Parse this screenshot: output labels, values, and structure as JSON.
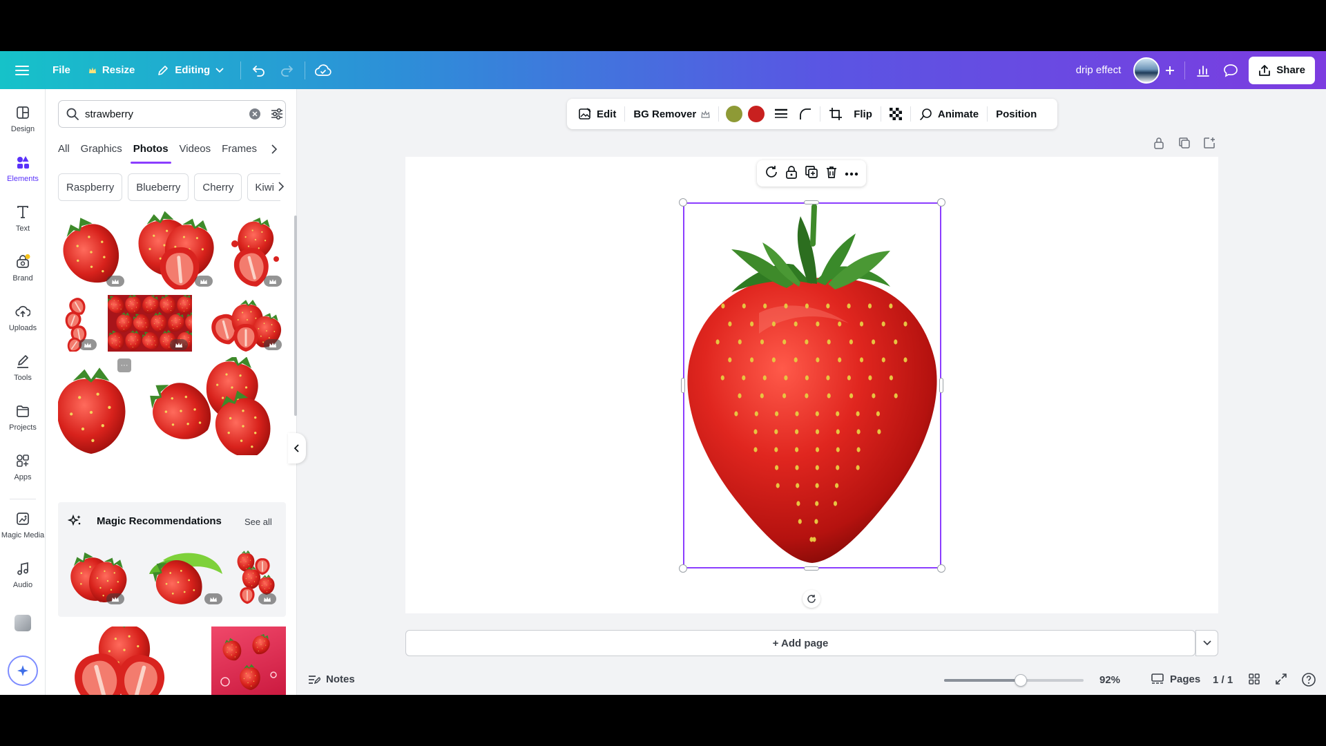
{
  "topbar": {
    "file": "File",
    "resize": "Resize",
    "editing": "Editing",
    "design_name": "drip effect",
    "share": "Share"
  },
  "rail": [
    {
      "label": "Design",
      "icon": "layout-icon"
    },
    {
      "label": "Elements",
      "icon": "elements-icon",
      "active": true
    },
    {
      "label": "Text",
      "icon": "text-icon"
    },
    {
      "label": "Brand",
      "icon": "brand-icon"
    },
    {
      "label": "Uploads",
      "icon": "cloud-upload-icon"
    },
    {
      "label": "Tools",
      "icon": "pen-icon"
    },
    {
      "label": "Projects",
      "icon": "folder-icon"
    },
    {
      "label": "Apps",
      "icon": "apps-icon"
    },
    {
      "label": "Magic Media",
      "icon": "magic-media-icon"
    },
    {
      "label": "Audio",
      "icon": "music-note-icon"
    }
  ],
  "panel": {
    "search_value": "strawberry",
    "tabs": [
      "All",
      "Graphics",
      "Photos",
      "Videos",
      "Frames"
    ],
    "active_tab": "Photos",
    "chips": [
      "Raspberry",
      "Blueberry",
      "Cherry",
      "Kiwi"
    ],
    "magic_title": "Magic Recommendations",
    "see_all": "See all"
  },
  "context_toolbar": {
    "edit": "Edit",
    "bg_remover": "BG Remover",
    "swatches": [
      "#8e9a36",
      "#c8201f"
    ],
    "flip": "Flip",
    "animate": "Animate",
    "position": "Position"
  },
  "canvas": {
    "add_page": "+ Add page"
  },
  "bottom": {
    "notes": "Notes",
    "zoom_fraction": 0.55,
    "zoom_text": "92%",
    "pages": "Pages",
    "page_count": "1 / 1"
  },
  "colors": {
    "accent": "#8b3dff",
    "strawberry": "#d9231f",
    "leaf": "#3e8a2a"
  }
}
